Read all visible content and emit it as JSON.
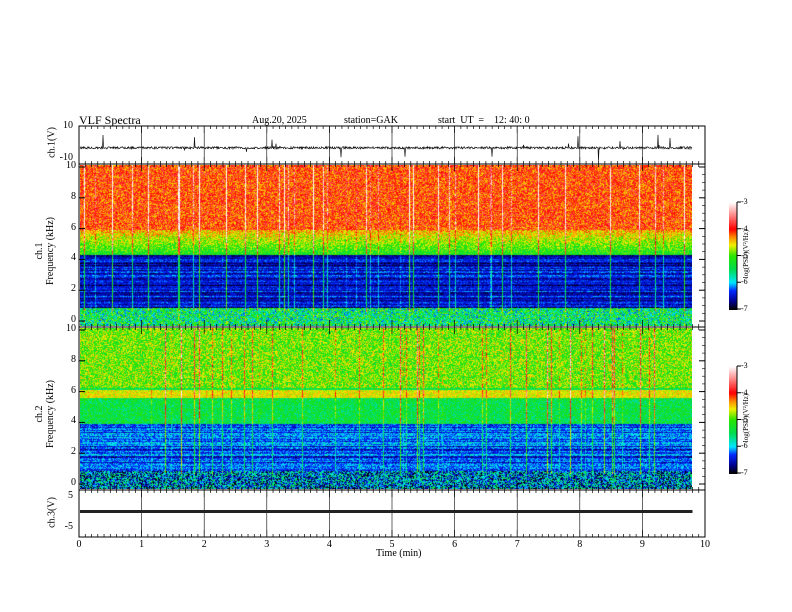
{
  "header": {
    "title": "VLF  Spectra",
    "date": "Aug.20, 2025",
    "station": "station=GAK",
    "start": "start  UT  =    12: 40: 0"
  },
  "chart_data": {
    "type": "heatmap",
    "xlabel": "Time  (min)",
    "xlim": [
      0,
      10
    ],
    "xticks": [
      "0",
      "1",
      "2",
      "3",
      "4",
      "5",
      "6",
      "7",
      "8",
      "9",
      "10"
    ],
    "data_end_min": 9.8,
    "panels": [
      {
        "name": "ch1-waveform",
        "type": "line",
        "ylabel": "ch.1(V)",
        "ylim": [
          -10,
          10
        ],
        "yticks": [
          "10",
          "-10"
        ],
        "baseline": -2
      },
      {
        "name": "ch1-spectrogram",
        "type": "heatmap",
        "ylabel1": "ch.1",
        "ylabel2": "Frequency  (kHz)",
        "ylim": [
          0,
          10
        ],
        "yticks": [
          "0",
          "2",
          "4",
          "6",
          "8",
          "10"
        ],
        "colorbar": {
          "label": "log(PSD)(V²/Hz)",
          "range": [
            -7,
            -3
          ],
          "ticks": [
            "-3",
            "-4",
            "-5",
            "-6",
            "-7"
          ]
        }
      },
      {
        "name": "ch2-spectrogram",
        "type": "heatmap",
        "ylabel1": "ch.2",
        "ylabel2": "Frequency  (kHz)",
        "ylim": [
          0,
          10
        ],
        "yticks": [
          "0",
          "2",
          "4",
          "6",
          "8",
          "10"
        ],
        "colorbar": {
          "label": "log(PSD)(V²/Hz)",
          "range": [
            -7,
            -3
          ],
          "ticks": [
            "-3",
            "-4",
            "-5",
            "-6",
            "-7"
          ]
        }
      },
      {
        "name": "ch3-waveform",
        "type": "line",
        "ylabel": "ch.3(V)",
        "ylim": [
          -5,
          5
        ],
        "yticks": [
          "5",
          "-5"
        ],
        "baseline": 0
      }
    ]
  }
}
